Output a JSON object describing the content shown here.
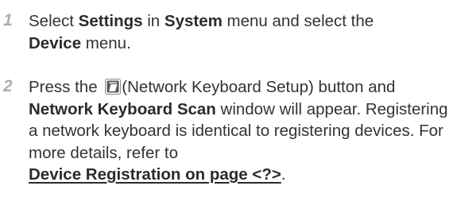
{
  "steps": [
    {
      "number": "1",
      "parts": {
        "t1": "Select ",
        "b1": "Settings",
        "t2": " in ",
        "b2": "System",
        "t3": " menu and select the ",
        "b3": "Device",
        "t4": " menu."
      }
    },
    {
      "number": "2",
      "icon": "network-keyboard-setup-icon",
      "parts": {
        "t1": "Press the ",
        "t2": "(Network Keyboard Setup) button and ",
        "b1": "Network Keyboard Scan",
        "t3": " window will appear. Registering a network keyboard is identical to registering devices. For more details, refer to ",
        "link": "Device Registration on page <?>",
        "t4": "."
      }
    }
  ],
  "colors": {
    "text": "#333333",
    "step_number": "#aeaeae",
    "icon_fill": "#555555"
  }
}
